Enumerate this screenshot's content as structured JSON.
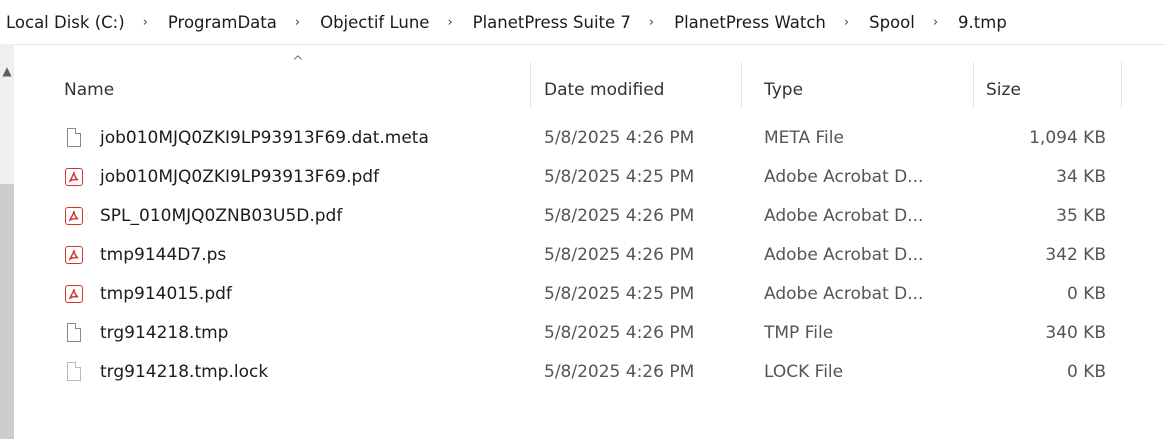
{
  "breadcrumb": {
    "items": [
      "Local Disk (C:)",
      "ProgramData",
      "Objectif Lune",
      "PlanetPress Suite 7",
      "PlanetPress Watch",
      "Spool",
      "9.tmp"
    ],
    "separator": "›"
  },
  "columns": {
    "name": "Name",
    "date": "Date modified",
    "type": "Type",
    "size": "Size",
    "sort_indicator": "^"
  },
  "files": [
    {
      "icon": "document-icon",
      "name": "job010MJQ0ZKI9LP93913F69.dat.meta",
      "date": "5/8/2025 4:26 PM",
      "type": "META File",
      "size": "1,094 KB"
    },
    {
      "icon": "pdf-icon",
      "name": "job010MJQ0ZKI9LP93913F69.pdf",
      "date": "5/8/2025 4:25 PM",
      "type": "Adobe Acrobat D...",
      "size": "34 KB"
    },
    {
      "icon": "pdf-icon",
      "name": "SPL_010MJQ0ZNB03U5D.pdf",
      "date": "5/8/2025 4:26 PM",
      "type": "Adobe Acrobat D...",
      "size": "35 KB"
    },
    {
      "icon": "pdf-icon",
      "name": "tmp9144D7.ps",
      "date": "5/8/2025 4:26 PM",
      "type": "Adobe Acrobat D...",
      "size": "342 KB"
    },
    {
      "icon": "pdf-icon",
      "name": "tmp914015.pdf",
      "date": "5/8/2025 4:25 PM",
      "type": "Adobe Acrobat D...",
      "size": "0 KB"
    },
    {
      "icon": "document-icon",
      "name": "trg914218.tmp",
      "date": "5/8/2025 4:26 PM",
      "type": "TMP File",
      "size": "340 KB"
    },
    {
      "icon": "document-light-icon",
      "name": "trg914218.tmp.lock",
      "date": "5/8/2025 4:26 PM",
      "type": "LOCK File",
      "size": "0 KB"
    }
  ],
  "colors": {
    "pdf_red": "#d0342c",
    "hover_blue": "#e5f3ff"
  }
}
